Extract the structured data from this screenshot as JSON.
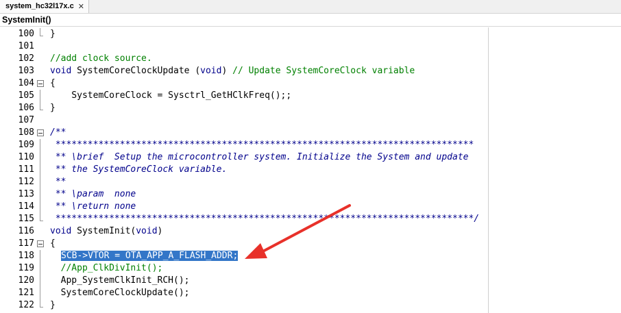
{
  "tab": {
    "label": "system_hc32l17x.c",
    "close": "✕"
  },
  "function_bar": {
    "label": "SystemInit()"
  },
  "lines": [
    {
      "num": "100",
      "text": "}"
    },
    {
      "num": "101",
      "text": ""
    },
    {
      "num": "102",
      "text": "//add clock source."
    },
    {
      "num": "103",
      "kw1": "void",
      "mid": " SystemCoreClockUpdate (",
      "kw2": "void",
      "end": ") ",
      "comment": "// Update SystemCoreClock variable"
    },
    {
      "num": "104",
      "text": "{"
    },
    {
      "num": "105",
      "text": "    SystemCoreClock = Sysctrl_GetHClkFreq();;"
    },
    {
      "num": "106",
      "text": "}"
    },
    {
      "num": "107",
      "text": ""
    },
    {
      "num": "108",
      "text": "/**"
    },
    {
      "num": "109",
      "text": " ******************************************************************************"
    },
    {
      "num": "110",
      "text": " ** \\brief  Setup the microcontroller system. Initialize the System and update"
    },
    {
      "num": "111",
      "text": " ** the SystemCoreClock variable."
    },
    {
      "num": "112",
      "text": " **"
    },
    {
      "num": "113",
      "text": " ** \\param  none"
    },
    {
      "num": "114",
      "text": " ** \\return none"
    },
    {
      "num": "115",
      "text": " ******************************************************************************/"
    },
    {
      "num": "116",
      "kw1": "void",
      "mid": " SystemInit(",
      "kw2": "void",
      "end": ")"
    },
    {
      "num": "117",
      "text": "{"
    },
    {
      "num": "118",
      "text": "SCB->VTOR = OTA_APP_A_FLASH_ADDR;"
    },
    {
      "num": "119",
      "text": "  //App_ClkDivInit();"
    },
    {
      "num": "120",
      "text": "  App_SystemClkInit_RCH();"
    },
    {
      "num": "121",
      "text": "  SystemCoreClockUpdate();"
    },
    {
      "num": "122",
      "text": "}"
    }
  ],
  "colors": {
    "keyword": "#00008b",
    "comment": "#008000",
    "selection": "#3376c8",
    "arrow": "#e8312a"
  }
}
